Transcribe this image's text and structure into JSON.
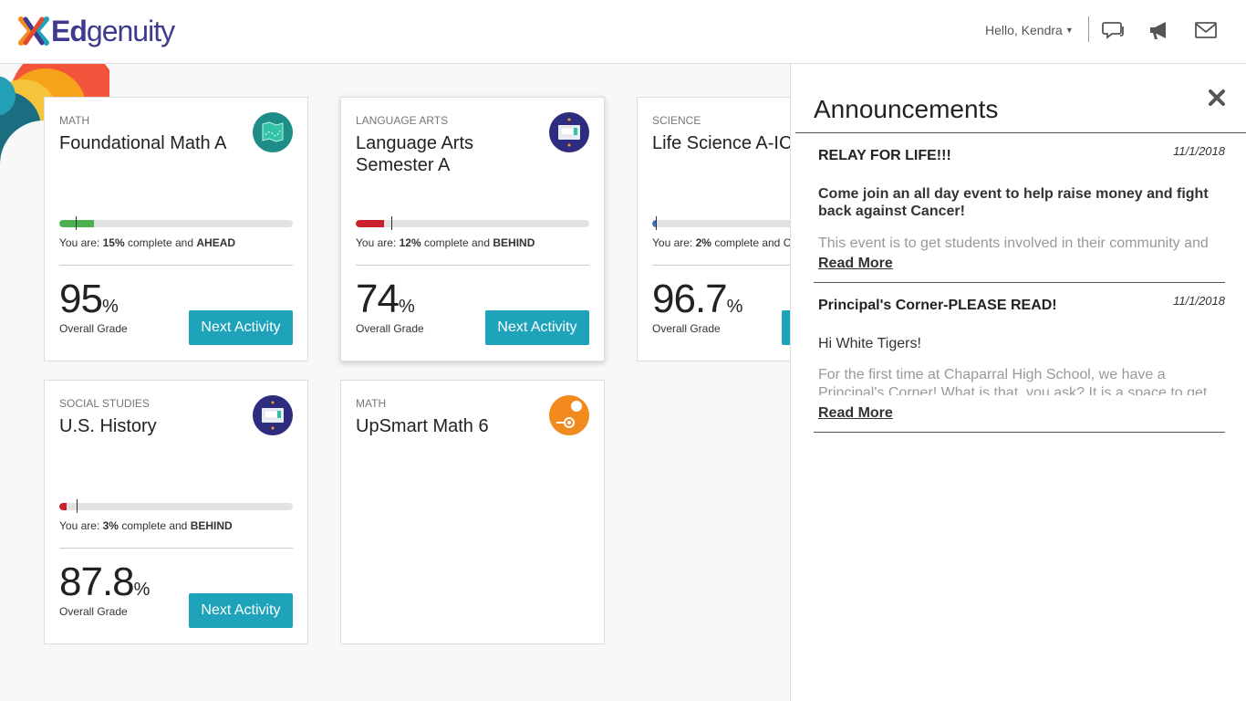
{
  "brand": {
    "name_first": "Ed",
    "name_rest": "genuity",
    "colors": {
      "primary": "#3d3a8f",
      "accent": "#1ea3bb"
    }
  },
  "header": {
    "greeting": "Hello, Kendra",
    "icons": [
      "chat-icon",
      "megaphone-icon",
      "mail-icon"
    ]
  },
  "courses": [
    {
      "subject": "MATH",
      "title": "Foundational Math A",
      "progress": 15,
      "status": "AHEAD",
      "status_color": "#4caf50",
      "grade": "95",
      "grade_label": "Overall Grade",
      "button": "Next Activity",
      "icon": "map-icon"
    },
    {
      "subject": "LANGUAGE ARTS",
      "title": "Language Arts Semester A",
      "progress": 12,
      "status": "BEHIND",
      "status_color": "#cc1f2e",
      "grade": "74",
      "grade_label": "Overall Grade",
      "button": "Next Activity",
      "icon": "screen-icon"
    },
    {
      "subject": "SCIENCE",
      "title": "Life Science A-IC",
      "progress": 2,
      "status": "C",
      "status_color": "#3a70c0",
      "grade": "96.7",
      "grade_label": "Overall Grade",
      "button": "",
      "icon": ""
    },
    {
      "subject": "SOCIAL STUDIES",
      "title": "U.S. History",
      "progress": 3,
      "status": "BEHIND",
      "status_color": "#cc1f2e",
      "grade": "87.8",
      "grade_label": "Overall Grade",
      "button": "Next Activity",
      "icon": "screen-icon"
    },
    {
      "subject": "MATH",
      "title": "UpSmart Math 6",
      "icon": "orbit-icon"
    }
  ],
  "status_prefix": "You are:",
  "status_mid": "complete and",
  "pct_sign": "%",
  "announcements": {
    "title": "Announcements",
    "items": [
      {
        "title": "RELAY FOR LIFE!!!",
        "date": "11/1/2018",
        "subtitle": "Come join an all day event to help raise money and fight back against Cancer!",
        "body": "This event is to get students involved in their community and",
        "more": "Read More"
      },
      {
        "title": "Principal's Corner-PLEASE READ!",
        "date": "11/1/2018",
        "subtitle": "Hi White Tigers!",
        "body": "For the first time at Chaparral High School, we have a Principal's Corner! What is that, you ask? It is a space to get",
        "more": "Read More"
      }
    ]
  }
}
